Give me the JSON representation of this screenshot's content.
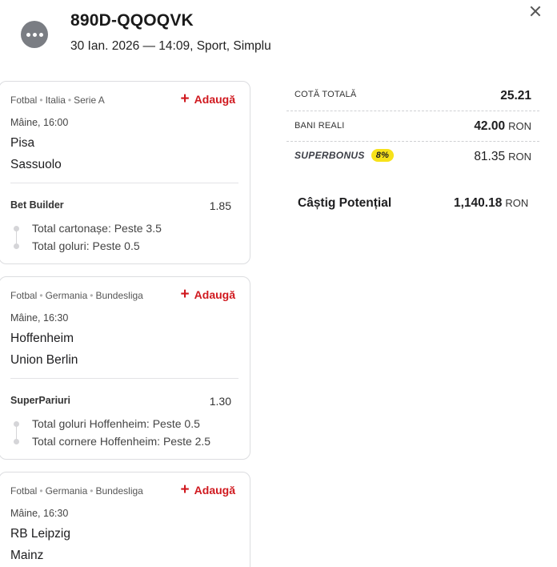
{
  "header": {
    "code": "890D-QQOQVK",
    "meta": "30 Ian. 2026 — 14:09, Sport, Simplu",
    "menu_icon": "more-dots-icon",
    "close_icon": "close-icon"
  },
  "cards": [
    {
      "sport": "Fotbal",
      "country": "Italia",
      "league": "Serie A",
      "add_label": "Adaugă",
      "time": "Mâine, 16:00",
      "home": "Pisa",
      "away": "Sassuolo",
      "market": "Bet Builder",
      "odd": "1.85",
      "selections": [
        "Total cartonașe: Peste 3.5",
        "Total goluri: Peste 0.5"
      ]
    },
    {
      "sport": "Fotbal",
      "country": "Germania",
      "league": "Bundesliga",
      "add_label": "Adaugă",
      "time": "Mâine, 16:30",
      "home": "Hoffenheim",
      "away": "Union Berlin",
      "market": "SuperPariuri",
      "odd": "1.30",
      "selections": [
        "Total goluri Hoffenheim: Peste 0.5",
        "Total cornere Hoffenheim: Peste 2.5"
      ]
    },
    {
      "sport": "Fotbal",
      "country": "Germania",
      "league": "Bundesliga",
      "add_label": "Adaugă",
      "time": "Mâine, 16:30",
      "home": "RB Leipzig",
      "away": "Mainz"
    }
  ],
  "summary": {
    "total_odds_label": "COTĂ TOTALĂ",
    "total_odds": "25.21",
    "stake_label": "BANI REALI",
    "stake": "42.00",
    "superbonus_label": "SUPERBONUS",
    "superbonus_pct": "8%",
    "superbonus_value": "81.35",
    "currency": "RON",
    "win_label": "Câștig Potențial",
    "win_value": "1,140.18"
  },
  "colors": {
    "accent_red": "#d0191f",
    "badge_yellow": "#f7e21a",
    "border": "#dcdde0"
  }
}
